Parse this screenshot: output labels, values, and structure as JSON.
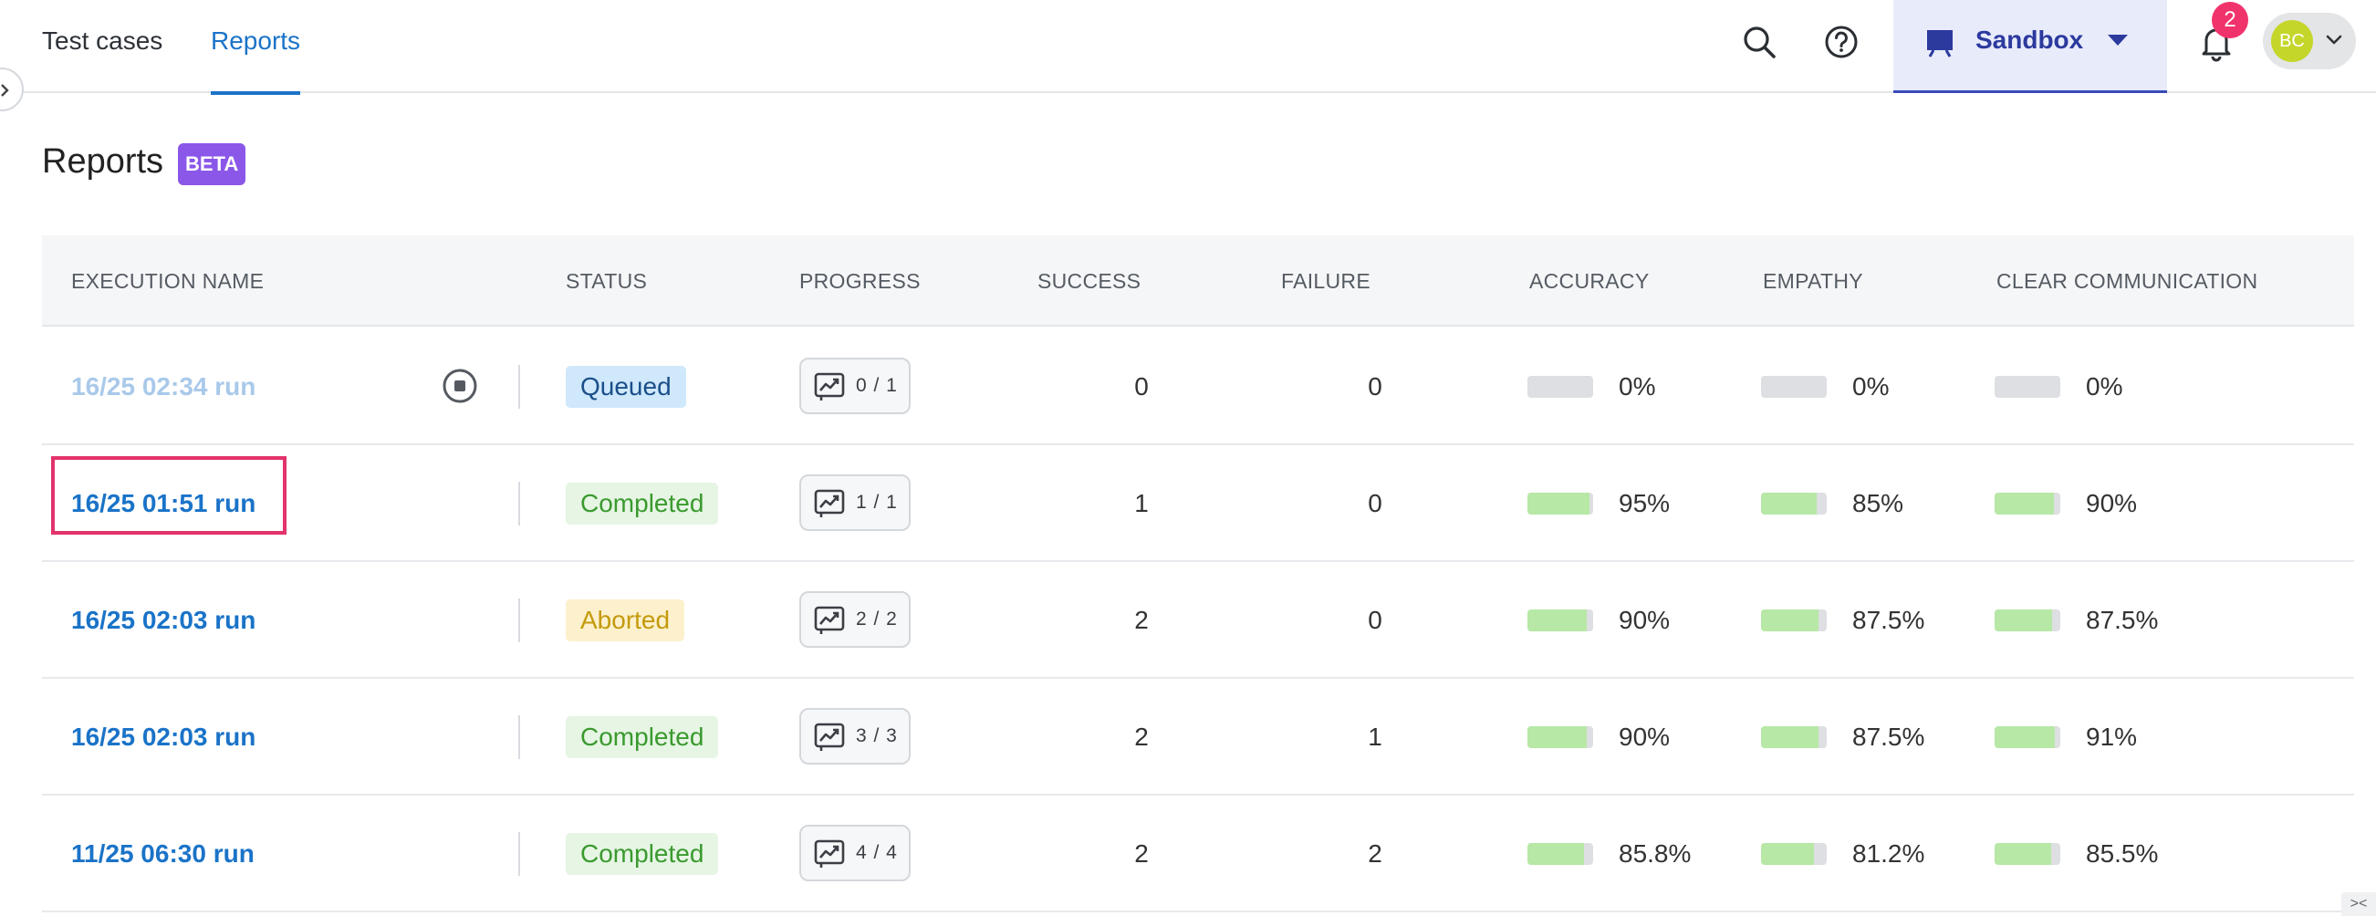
{
  "nav": {
    "tabs": [
      {
        "label": "Test cases"
      },
      {
        "label": "Reports"
      }
    ],
    "environment": "Sandbox",
    "notification_count": "2",
    "user_initials": "BC"
  },
  "page": {
    "title": "Reports",
    "badge": "BETA"
  },
  "table": {
    "headers": {
      "execution_name": "EXECUTION NAME",
      "status": "STATUS",
      "progress": "PROGRESS",
      "success": "SUCCESS",
      "failure": "FAILURE",
      "accuracy": "ACCURACY",
      "empathy": "EMPATHY",
      "clear_communication": "CLEAR COMMUNICATION"
    },
    "rows": [
      {
        "name": "16/25 02:34 run",
        "status": "Queued",
        "progress": "0 / 1",
        "success": "0",
        "failure": "0",
        "accuracy": "0%",
        "accuracy_fill": 0,
        "empathy": "0%",
        "empathy_fill": 0,
        "clear": "0%",
        "clear_fill": 0
      },
      {
        "name": "16/25 01:51 run",
        "status": "Completed",
        "progress": "1 / 1",
        "success": "1",
        "failure": "0",
        "accuracy": "95%",
        "accuracy_fill": 0.95,
        "empathy": "85%",
        "empathy_fill": 0.85,
        "clear": "90%",
        "clear_fill": 0.9
      },
      {
        "name": "16/25 02:03 run",
        "status": "Aborted",
        "progress": "2 / 2",
        "success": "2",
        "failure": "0",
        "accuracy": "90%",
        "accuracy_fill": 0.9,
        "empathy": "87.5%",
        "empathy_fill": 0.875,
        "clear": "87.5%",
        "clear_fill": 0.875
      },
      {
        "name": "16/25 02:03 run",
        "status": "Completed",
        "progress": "3 / 3",
        "success": "2",
        "failure": "1",
        "accuracy": "90%",
        "accuracy_fill": 0.9,
        "empathy": "87.5%",
        "empathy_fill": 0.875,
        "clear": "91%",
        "clear_fill": 0.91
      },
      {
        "name": "11/25 06:30 run",
        "status": "Completed",
        "progress": "4 / 4",
        "success": "2",
        "failure": "2",
        "accuracy": "85.8%",
        "accuracy_fill": 0.858,
        "empathy": "81.2%",
        "empathy_fill": 0.812,
        "clear": "85.5%",
        "clear_fill": 0.855
      }
    ]
  },
  "colors": {
    "accent": "#1a73c8",
    "highlight": "#e2336b",
    "status_completed": "#3a9a2e",
    "status_queued": "#1a4f8a",
    "status_aborted": "#c49a0c",
    "score_fill": "#b7e8a6"
  },
  "icons": {
    "search": "search-icon",
    "help": "help-icon",
    "environment": "presentation-icon",
    "notifications": "bell-icon",
    "progress": "chart-trend-icon",
    "stop": "stop-circle-icon"
  }
}
